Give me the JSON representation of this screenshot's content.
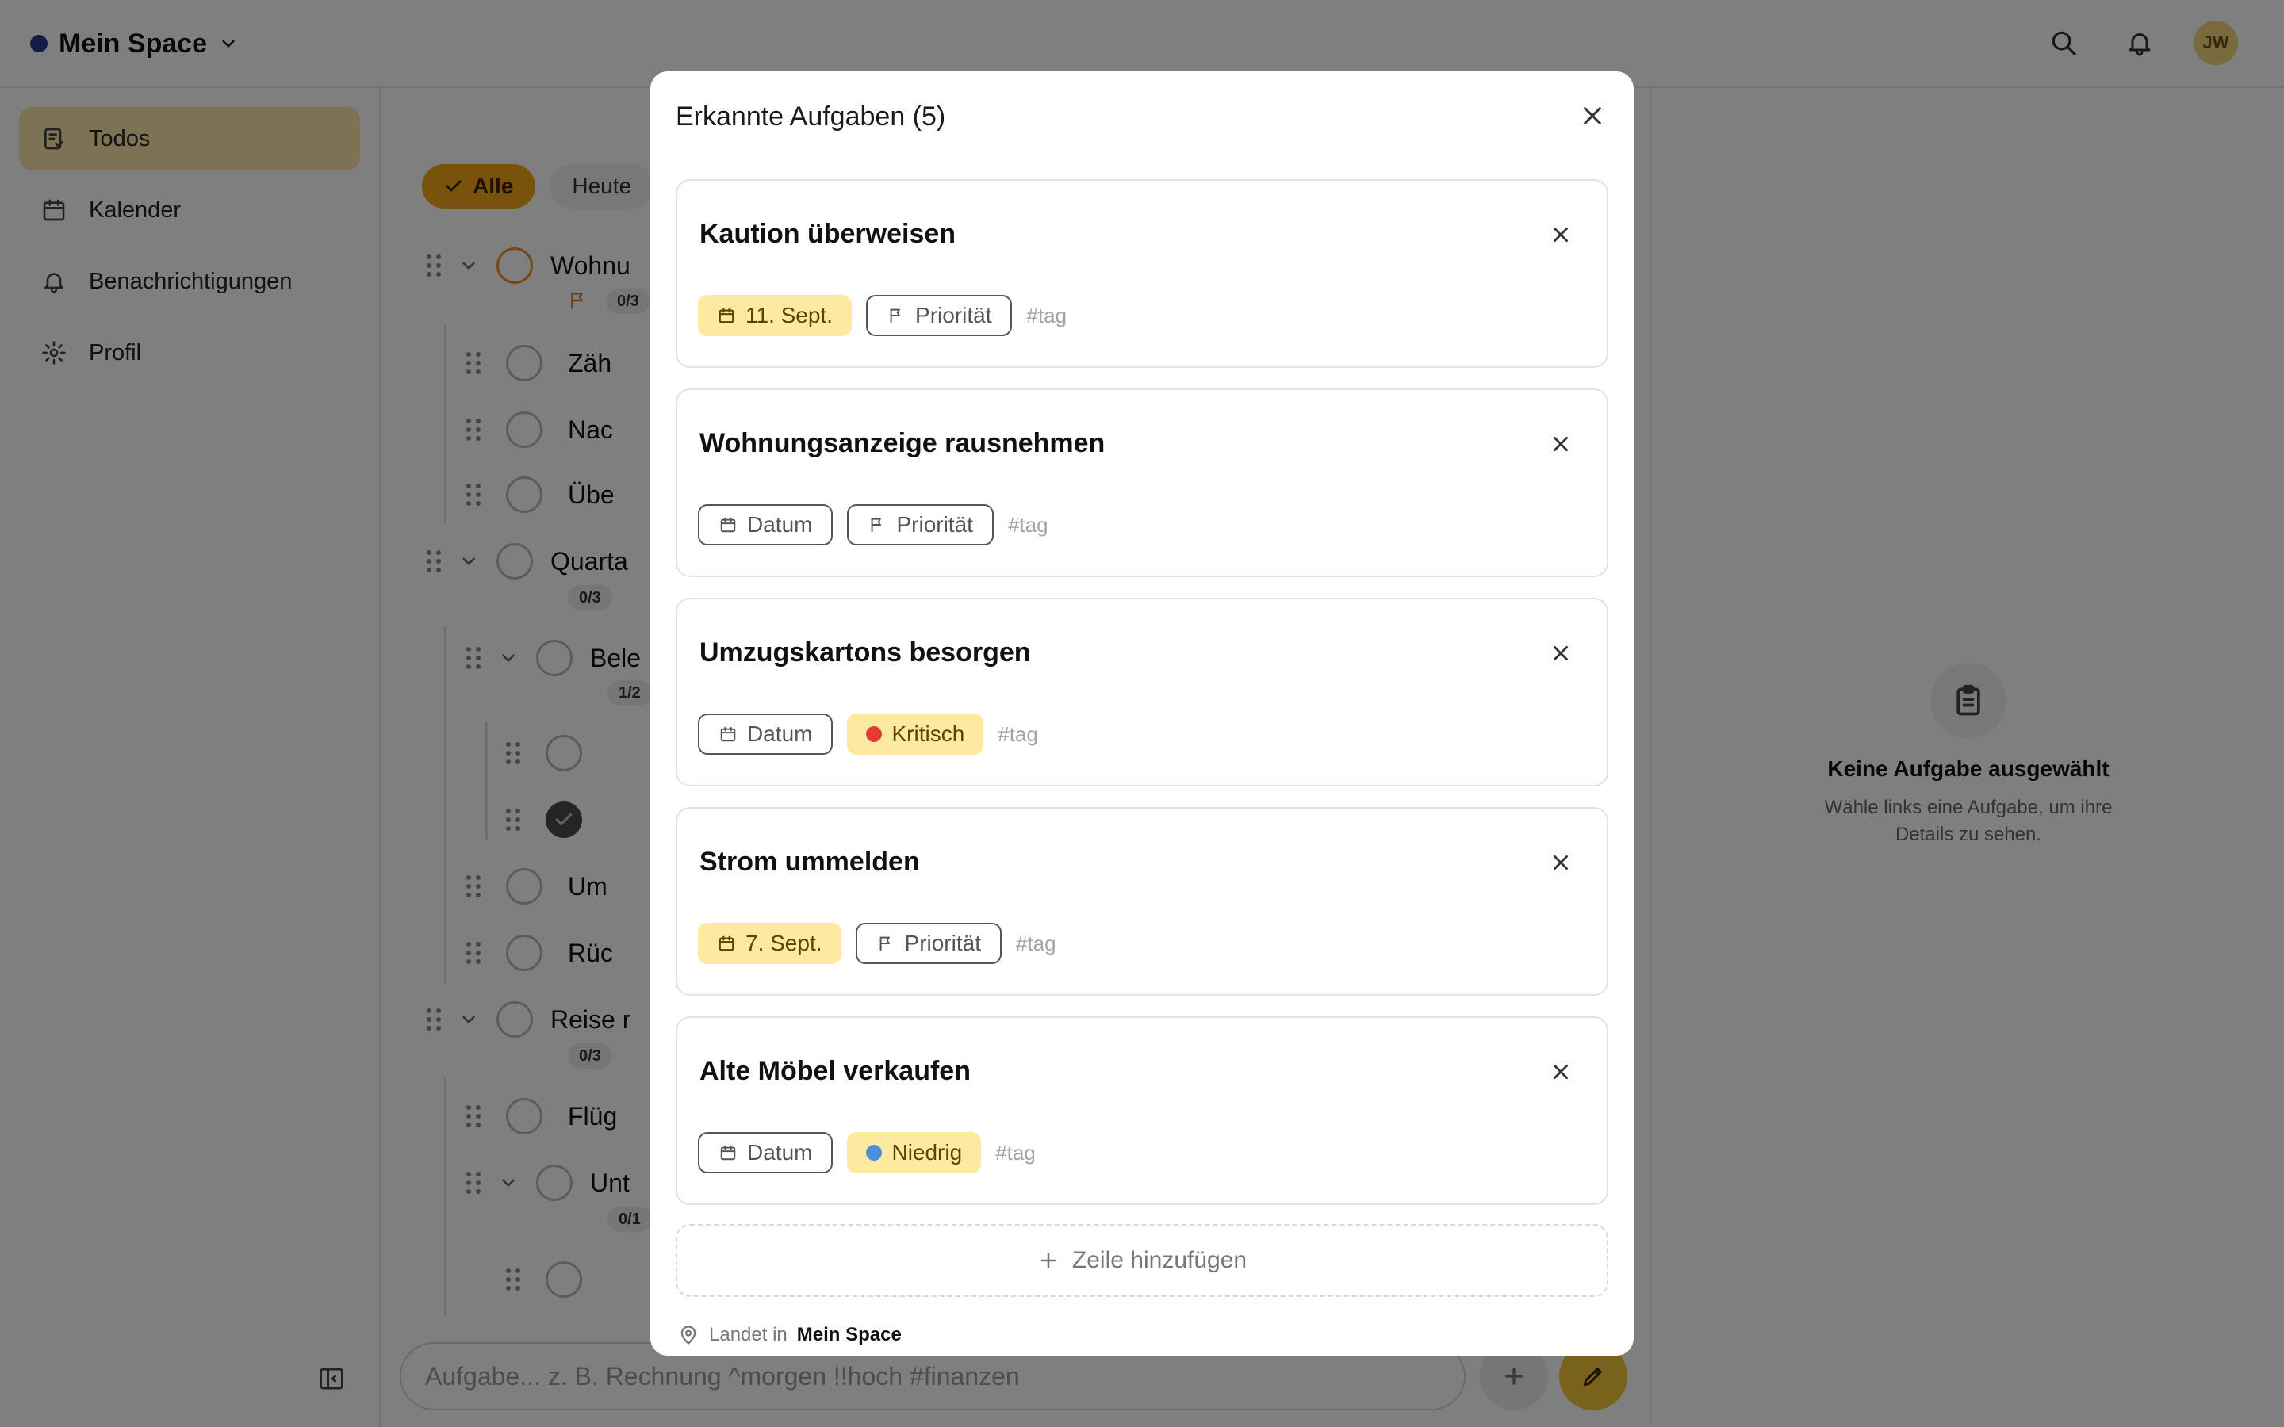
{
  "header": {
    "space_name": "Mein Space",
    "avatar_initials": "JW"
  },
  "sidebar": {
    "items": [
      {
        "label": "Todos",
        "icon": "todo-list-icon",
        "active": true
      },
      {
        "label": "Kalender",
        "icon": "calendar-icon",
        "active": false
      },
      {
        "label": "Benachrichtigungen",
        "icon": "bell-icon",
        "active": false
      },
      {
        "label": "Profil",
        "icon": "gear-icon",
        "active": false
      }
    ]
  },
  "filters": {
    "all": "Alle",
    "today": "Heute"
  },
  "tasks": {
    "rows": [
      {
        "title": "Wohnu",
        "count": "0/3"
      },
      {
        "title": "Zäh"
      },
      {
        "title": "Nac"
      },
      {
        "title": "Übe"
      },
      {
        "title": "Quarta",
        "count": "0/3"
      },
      {
        "title": "Bele",
        "count": "1/2"
      },
      {
        "title": ""
      },
      {
        "title": ""
      },
      {
        "title": "Um"
      },
      {
        "title": "Rüc"
      },
      {
        "title": "Reise r",
        "count": "0/3"
      },
      {
        "title": "Flüg"
      },
      {
        "title": "Unt",
        "count": "0/1"
      },
      {
        "title": ""
      }
    ]
  },
  "detail": {
    "empty_title": "Keine Aufgabe ausgewählt",
    "empty_subtitle": "Wähle links eine Aufgabe, um ihre Details zu sehen."
  },
  "composer": {
    "placeholder": "Aufgabe... z. B. Rechnung ^morgen !!hoch #finanzen"
  },
  "modal": {
    "title": "Erkannte Aufgaben (5)",
    "cards": [
      {
        "title": "Kaution überweisen",
        "date": "11. Sept.",
        "priority": "Priorität",
        "tag": "#tag"
      },
      {
        "title": "Wohnungsanzeige rausnehmen",
        "date": "Datum",
        "priority": "Priorität",
        "tag": "#tag"
      },
      {
        "title": "Umzugskartons besorgen",
        "date": "Datum",
        "priority": "Kritisch",
        "tag": "#tag"
      },
      {
        "title": "Strom ummelden",
        "date": "7. Sept.",
        "priority": "Priorität",
        "tag": "#tag"
      },
      {
        "title": "Alte Möbel verkaufen",
        "date": "Datum",
        "priority": "Niedrig",
        "tag": "#tag"
      }
    ],
    "add_row": "Zeile hinzufügen",
    "landing_prefix": "Landet in",
    "landing_space": "Mein Space"
  },
  "colors": {
    "accent": "#f2a417",
    "highlight": "#fdeaa0",
    "critical": "#e53935",
    "low": "#4a90d9",
    "space_dot": "#2b3a8f"
  }
}
